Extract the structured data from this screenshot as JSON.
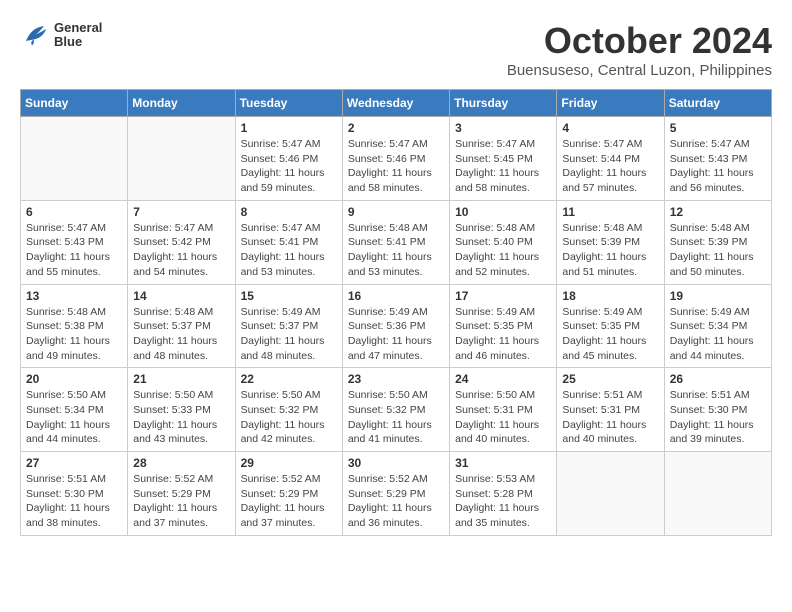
{
  "header": {
    "logo_line1": "General",
    "logo_line2": "Blue",
    "month": "October 2024",
    "location": "Buensuseso, Central Luzon, Philippines"
  },
  "weekdays": [
    "Sunday",
    "Monday",
    "Tuesday",
    "Wednesday",
    "Thursday",
    "Friday",
    "Saturday"
  ],
  "weeks": [
    [
      {
        "day": null
      },
      {
        "day": null
      },
      {
        "day": 1,
        "sunrise": "5:47 AM",
        "sunset": "5:46 PM",
        "daylight": "11 hours and 59 minutes."
      },
      {
        "day": 2,
        "sunrise": "5:47 AM",
        "sunset": "5:46 PM",
        "daylight": "11 hours and 58 minutes."
      },
      {
        "day": 3,
        "sunrise": "5:47 AM",
        "sunset": "5:45 PM",
        "daylight": "11 hours and 58 minutes."
      },
      {
        "day": 4,
        "sunrise": "5:47 AM",
        "sunset": "5:44 PM",
        "daylight": "11 hours and 57 minutes."
      },
      {
        "day": 5,
        "sunrise": "5:47 AM",
        "sunset": "5:43 PM",
        "daylight": "11 hours and 56 minutes."
      }
    ],
    [
      {
        "day": 6,
        "sunrise": "5:47 AM",
        "sunset": "5:43 PM",
        "daylight": "11 hours and 55 minutes."
      },
      {
        "day": 7,
        "sunrise": "5:47 AM",
        "sunset": "5:42 PM",
        "daylight": "11 hours and 54 minutes."
      },
      {
        "day": 8,
        "sunrise": "5:47 AM",
        "sunset": "5:41 PM",
        "daylight": "11 hours and 53 minutes."
      },
      {
        "day": 9,
        "sunrise": "5:48 AM",
        "sunset": "5:41 PM",
        "daylight": "11 hours and 53 minutes."
      },
      {
        "day": 10,
        "sunrise": "5:48 AM",
        "sunset": "5:40 PM",
        "daylight": "11 hours and 52 minutes."
      },
      {
        "day": 11,
        "sunrise": "5:48 AM",
        "sunset": "5:39 PM",
        "daylight": "11 hours and 51 minutes."
      },
      {
        "day": 12,
        "sunrise": "5:48 AM",
        "sunset": "5:39 PM",
        "daylight": "11 hours and 50 minutes."
      }
    ],
    [
      {
        "day": 13,
        "sunrise": "5:48 AM",
        "sunset": "5:38 PM",
        "daylight": "11 hours and 49 minutes."
      },
      {
        "day": 14,
        "sunrise": "5:48 AM",
        "sunset": "5:37 PM",
        "daylight": "11 hours and 48 minutes."
      },
      {
        "day": 15,
        "sunrise": "5:49 AM",
        "sunset": "5:37 PM",
        "daylight": "11 hours and 48 minutes."
      },
      {
        "day": 16,
        "sunrise": "5:49 AM",
        "sunset": "5:36 PM",
        "daylight": "11 hours and 47 minutes."
      },
      {
        "day": 17,
        "sunrise": "5:49 AM",
        "sunset": "5:35 PM",
        "daylight": "11 hours and 46 minutes."
      },
      {
        "day": 18,
        "sunrise": "5:49 AM",
        "sunset": "5:35 PM",
        "daylight": "11 hours and 45 minutes."
      },
      {
        "day": 19,
        "sunrise": "5:49 AM",
        "sunset": "5:34 PM",
        "daylight": "11 hours and 44 minutes."
      }
    ],
    [
      {
        "day": 20,
        "sunrise": "5:50 AM",
        "sunset": "5:34 PM",
        "daylight": "11 hours and 44 minutes."
      },
      {
        "day": 21,
        "sunrise": "5:50 AM",
        "sunset": "5:33 PM",
        "daylight": "11 hours and 43 minutes."
      },
      {
        "day": 22,
        "sunrise": "5:50 AM",
        "sunset": "5:32 PM",
        "daylight": "11 hours and 42 minutes."
      },
      {
        "day": 23,
        "sunrise": "5:50 AM",
        "sunset": "5:32 PM",
        "daylight": "11 hours and 41 minutes."
      },
      {
        "day": 24,
        "sunrise": "5:50 AM",
        "sunset": "5:31 PM",
        "daylight": "11 hours and 40 minutes."
      },
      {
        "day": 25,
        "sunrise": "5:51 AM",
        "sunset": "5:31 PM",
        "daylight": "11 hours and 40 minutes."
      },
      {
        "day": 26,
        "sunrise": "5:51 AM",
        "sunset": "5:30 PM",
        "daylight": "11 hours and 39 minutes."
      }
    ],
    [
      {
        "day": 27,
        "sunrise": "5:51 AM",
        "sunset": "5:30 PM",
        "daylight": "11 hours and 38 minutes."
      },
      {
        "day": 28,
        "sunrise": "5:52 AM",
        "sunset": "5:29 PM",
        "daylight": "11 hours and 37 minutes."
      },
      {
        "day": 29,
        "sunrise": "5:52 AM",
        "sunset": "5:29 PM",
        "daylight": "11 hours and 37 minutes."
      },
      {
        "day": 30,
        "sunrise": "5:52 AM",
        "sunset": "5:29 PM",
        "daylight": "11 hours and 36 minutes."
      },
      {
        "day": 31,
        "sunrise": "5:53 AM",
        "sunset": "5:28 PM",
        "daylight": "11 hours and 35 minutes."
      },
      {
        "day": null
      },
      {
        "day": null
      }
    ]
  ]
}
